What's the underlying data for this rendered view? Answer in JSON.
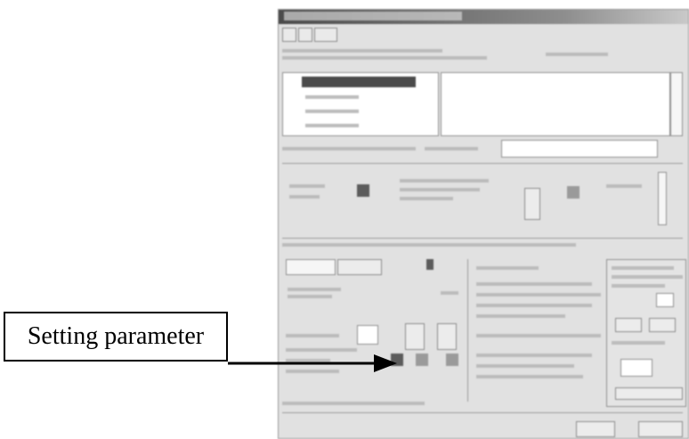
{
  "callout": {
    "label": "Setting parameter"
  }
}
